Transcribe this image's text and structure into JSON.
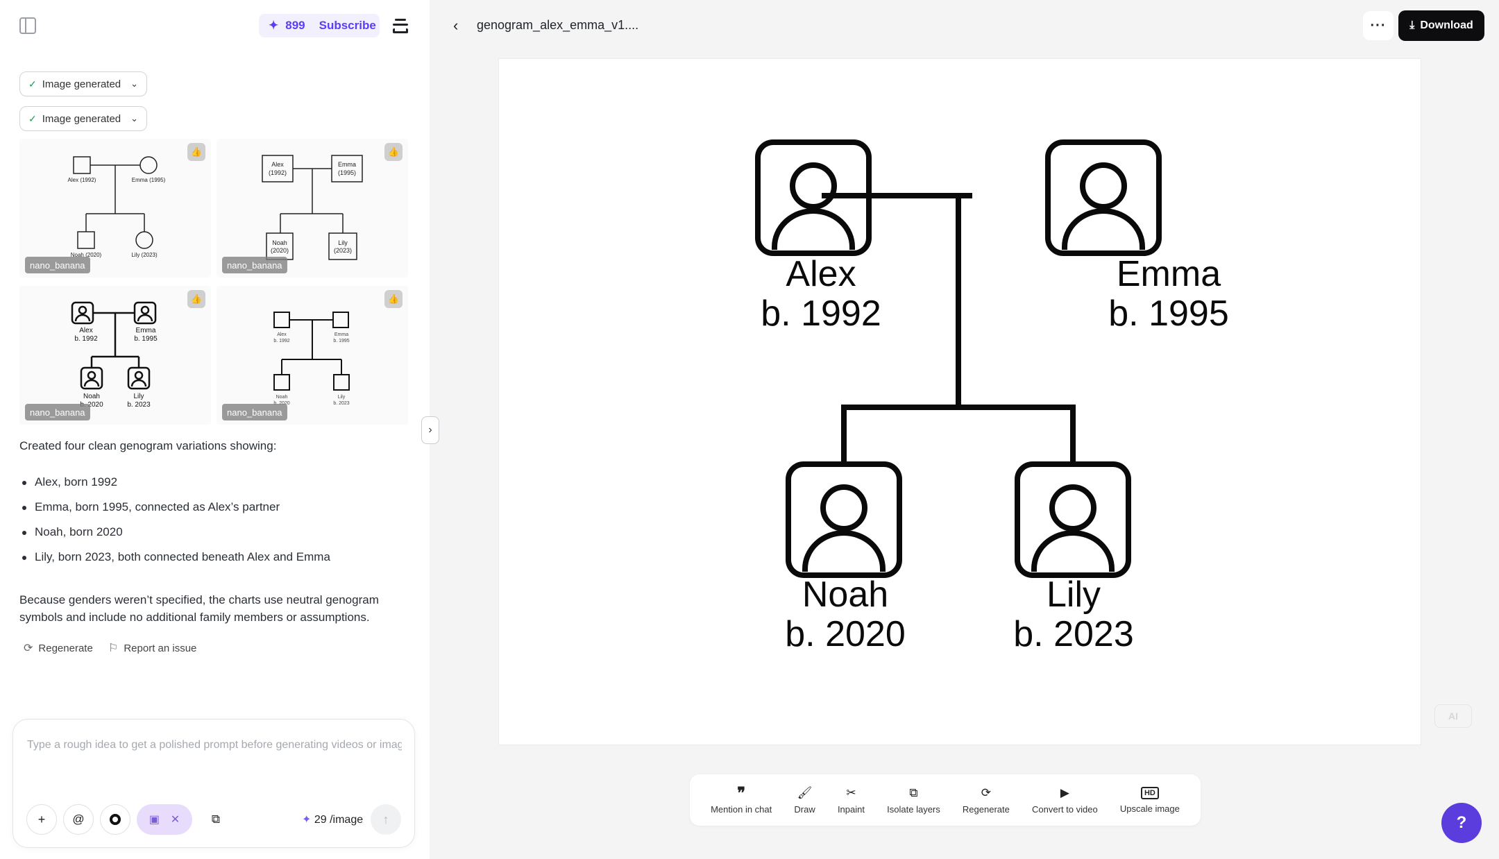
{
  "header": {
    "credits": "899",
    "subscribe_label": "Subscribe"
  },
  "chat": {
    "status_chips": [
      "Image generated",
      "Image generated"
    ],
    "thumbnails": [
      {
        "tag": "nano_banana",
        "labels": [
          "Alex (1992)",
          "Emma (1995)",
          "Noah (2020)",
          "Lily (2023)"
        ]
      },
      {
        "tag": "nano_banana",
        "labels": [
          "Alex",
          "(1992)",
          "Emma",
          "(1995)",
          "Noah",
          "(2020)",
          "Lily",
          "(2023)"
        ]
      },
      {
        "tag": "nano_banana",
        "labels": [
          "Alex",
          "b. 1992",
          "Emma",
          "b. 1995",
          "Noah",
          "b. 2020",
          "Lily",
          "b. 2023"
        ]
      },
      {
        "tag": "nano_banana",
        "labels": [
          "Alex",
          "b. 1992",
          "Emma",
          "b. 1995",
          "Noah",
          "b. 2020",
          "Lily",
          "b. 2023"
        ]
      }
    ],
    "intro": "Created four clean genogram variations showing:",
    "bullets": [
      "Alex, born 1992",
      "Emma, born 1995, connected as Alex’s partner",
      "Noah, born 2020",
      "Lily, born 2023, both connected beneath Alex and Emma"
    ],
    "outro_line1": "Because genders weren’t specified, the charts use neutral genogram",
    "outro_line2": "symbols and include no additional family members or assumptions.",
    "regenerate_label": "Regenerate",
    "report_label": "Report an issue"
  },
  "composer": {
    "placeholder": "Type a rough idea to get a polished prompt before generating videos or images",
    "cost": "29 /image"
  },
  "viewer": {
    "filename": "genogram_alex_emma_v1....",
    "download_label": "Download",
    "ai_badge": "AI",
    "people": [
      {
        "name": "Alex",
        "born": "b. 1992"
      },
      {
        "name": "Emma",
        "born": "b. 1995"
      },
      {
        "name": "Noah",
        "born": "b. 2020"
      },
      {
        "name": "Lily",
        "born": "b. 2023"
      }
    ]
  },
  "toolbar": {
    "items": [
      {
        "label": "Mention in chat",
        "icon": "quote-icon"
      },
      {
        "label": "Draw",
        "icon": "brush-icon"
      },
      {
        "label": "Inpaint",
        "icon": "scissors-icon"
      },
      {
        "label": "Isolate layers",
        "icon": "layers-icon"
      },
      {
        "label": "Regenerate",
        "icon": "refresh-icon"
      },
      {
        "label": "Convert to video",
        "icon": "play-icon"
      },
      {
        "label": "Upscale image",
        "icon": "hd-icon"
      }
    ]
  }
}
